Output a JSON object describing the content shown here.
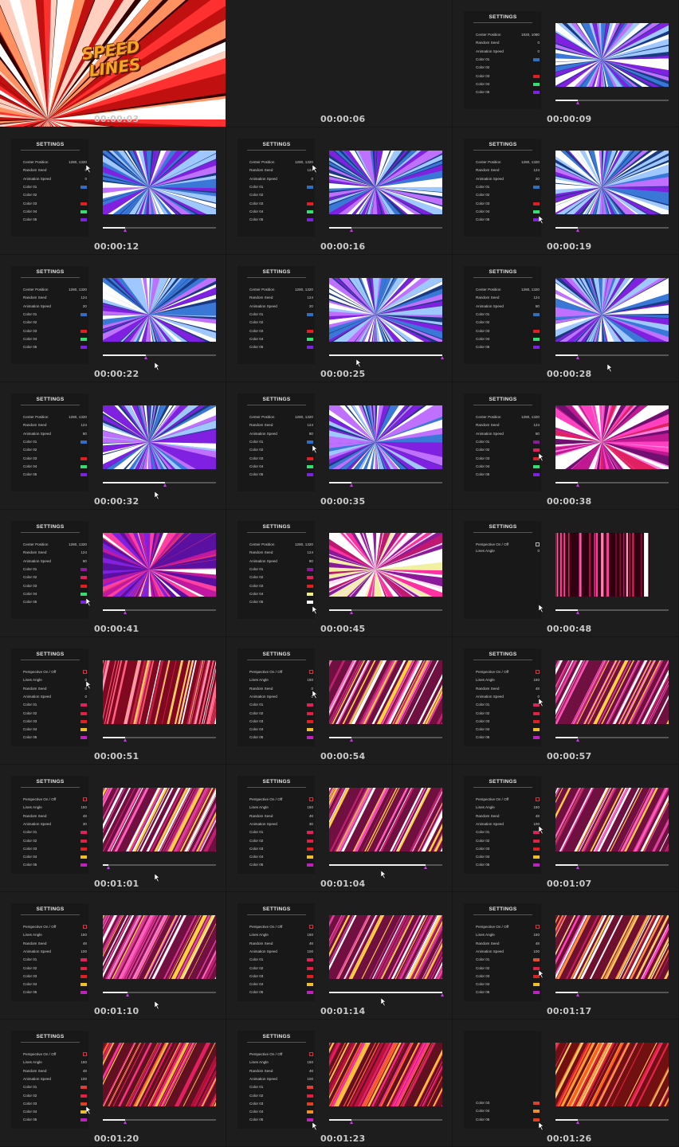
{
  "panel": {
    "title": "SETTINGS",
    "labels": {
      "center_position": "Center Position",
      "random_seed": "Random Seed",
      "animation_speed": "Animation Speed",
      "perspective": "Perspective On / Off",
      "lines_angle": "Lines Angle",
      "color_01": "Color 01",
      "color_02": "Color 02",
      "color_03": "Color 03",
      "color_04": "Color 04",
      "color_05": "Color 05"
    }
  },
  "title_art": {
    "line1": "SPEED",
    "line2": "LINES"
  },
  "colors": {
    "accent": "#c040e0",
    "background": "#1d1d1d"
  },
  "frames": [
    {
      "timestamp": "00:00:03",
      "kind": "intro"
    },
    {
      "timestamp": "00:00:06",
      "kind": "blank"
    },
    {
      "timestamp": "00:00:09",
      "kind": "radial",
      "center": "1920, 1080",
      "seed": "0",
      "speed": "0",
      "swatches": [
        "#2f6fbf",
        "",
        "#e02020",
        "#30e070",
        "#8020e0"
      ],
      "progress": 0.2,
      "preview": "blue-purple",
      "cursor": null
    },
    {
      "timestamp": "00:00:12",
      "kind": "radial",
      "center": "1280, 1320",
      "seed": "0",
      "speed": "0",
      "swatches": [
        "#2f6fbf",
        "",
        "#e02020",
        "#30e070",
        "#8020e0"
      ],
      "progress": 0.2,
      "preview": "blue-purple",
      "cursor": "seed"
    },
    {
      "timestamp": "00:00:16",
      "kind": "radial",
      "center": "1280, 1320",
      "seed": "124",
      "speed": "0",
      "swatches": [
        "#2f6fbf",
        "",
        "#e02020",
        "#30e070",
        "#8020e0"
      ],
      "progress": 0.2,
      "preview": "blue-purple",
      "cursor": "seed"
    },
    {
      "timestamp": "00:00:19",
      "kind": "radial",
      "center": "1280, 1320",
      "seed": "124",
      "speed": "20",
      "swatches": [
        "#2f6fbf",
        "",
        "#e02020",
        "#30e070",
        "#8020e0"
      ],
      "progress": 0.2,
      "preview": "blue-purple",
      "cursor": "color04"
    },
    {
      "timestamp": "00:00:22",
      "kind": "radial",
      "center": "1280, 1320",
      "seed": "124",
      "speed": "20",
      "swatches": [
        "#2f6fbf",
        "",
        "#e02020",
        "#30e070",
        "#8020e0"
      ],
      "progress": 0.38,
      "preview": "blue-purple",
      "cursor": "slider"
    },
    {
      "timestamp": "00:00:25",
      "kind": "radial",
      "center": "1280, 1320",
      "seed": "124",
      "speed": "20",
      "swatches": [
        "#2f6fbf",
        "",
        "#e02020",
        "#30e070",
        "#8020e0"
      ],
      "progress": 1.0,
      "preview": "blue-purple",
      "cursor": "slider"
    },
    {
      "timestamp": "00:00:28",
      "kind": "radial",
      "center": "1280, 1320",
      "seed": "124",
      "speed": "80",
      "swatches": [
        "#2f6fbf",
        "",
        "#e02020",
        "#30e070",
        "#8020e0"
      ],
      "progress": 0.2,
      "preview": "blue-purple",
      "cursor": "slider"
    },
    {
      "timestamp": "00:00:32",
      "kind": "radial",
      "center": "1280, 1320",
      "seed": "124",
      "speed": "80",
      "swatches": [
        "#2f6fbf",
        "",
        "#e02020",
        "#30e070",
        "#8020e0"
      ],
      "progress": 0.55,
      "preview": "blue-purple",
      "cursor": "slider"
    },
    {
      "timestamp": "00:00:35",
      "kind": "radial",
      "center": "1280, 1320",
      "seed": "124",
      "speed": "80",
      "swatches": [
        "#2f6fbf",
        "",
        "#e02020",
        "#30e070",
        "#8020e0"
      ],
      "progress": 0.2,
      "preview": "blue-purple",
      "cursor": "color01"
    },
    {
      "timestamp": "00:00:38",
      "kind": "radial",
      "center": "1280, 1320",
      "seed": "124",
      "speed": "80",
      "swatches": [
        "#8a1a9a",
        "#e0205a",
        "#e02020",
        "#30e070",
        "#8020e0"
      ],
      "progress": 0.2,
      "preview": "magenta",
      "cursor": "color02"
    },
    {
      "timestamp": "00:00:41",
      "kind": "radial",
      "center": "1280, 1320",
      "seed": "124",
      "speed": "80",
      "swatches": [
        "#8a1a9a",
        "#e0205a",
        "#e02020",
        "#30e070",
        "#8020e0"
      ],
      "progress": 0.2,
      "preview": "magenta-violet",
      "cursor": "color04"
    },
    {
      "timestamp": "00:00:45",
      "kind": "radial",
      "center": "1280, 1320",
      "seed": "124",
      "speed": "80",
      "swatches": [
        "#8a1a9a",
        "#e0205a",
        "#e02020",
        "#f0f080",
        "#ffffff"
      ],
      "progress": 0.2,
      "preview": "magenta-white",
      "cursor": "color05"
    },
    {
      "timestamp": "00:00:48",
      "kind": "vertical",
      "lines_angle": "0",
      "progress": 0.2,
      "cursor": "slider"
    },
    {
      "timestamp": "00:00:51",
      "kind": "parallel",
      "angle_val": "0",
      "seed": "0",
      "speed": "0",
      "swatches": [
        "#e0205a",
        "#e02040",
        "#e02020",
        "#f0c020",
        "#c020c0"
      ],
      "progress": 0.2,
      "preview": "fan-warm",
      "cursor": "perspective"
    },
    {
      "timestamp": "00:00:54",
      "kind": "parallel",
      "angle_val": "150",
      "seed": "0",
      "speed": "0",
      "swatches": [
        "#e0205a",
        "#e02040",
        "#e02020",
        "#f0c020",
        "#c020c0"
      ],
      "progress": 0.2,
      "preview": "diag-pink",
      "cursor": "seed"
    },
    {
      "timestamp": "00:00:57",
      "kind": "parallel",
      "angle_val": "150",
      "seed": "48",
      "speed": "0",
      "swatches": [
        "#e0205a",
        "#e02040",
        "#e02020",
        "#f0c020",
        "#c020c0"
      ],
      "progress": 0.2,
      "preview": "diag-pink",
      "cursor": "speed"
    },
    {
      "timestamp": "00:01:01",
      "kind": "parallel",
      "angle_val": "150",
      "seed": "48",
      "speed": "30",
      "swatches": [
        "#e0205a",
        "#e02040",
        "#e02020",
        "#f0c020",
        "#c020c0"
      ],
      "progress": 0.05,
      "preview": "diag-pink",
      "cursor": "slider"
    },
    {
      "timestamp": "00:01:04",
      "kind": "parallel",
      "angle_val": "150",
      "seed": "48",
      "speed": "30",
      "swatches": [
        "#e0205a",
        "#e02040",
        "#e02020",
        "#f0c020",
        "#c020c0"
      ],
      "progress": 0.85,
      "preview": "diag-pink",
      "cursor": "slider"
    },
    {
      "timestamp": "00:01:07",
      "kind": "parallel",
      "angle_val": "150",
      "seed": "48",
      "speed": "100",
      "swatches": [
        "#e0205a",
        "#e02040",
        "#e02020",
        "#f0c020",
        "#c020c0"
      ],
      "progress": 0.2,
      "preview": "diag-pink",
      "cursor": "speed"
    },
    {
      "timestamp": "00:01:10",
      "kind": "parallel",
      "angle_val": "150",
      "seed": "48",
      "speed": "100",
      "swatches": [
        "#e0205a",
        "#e02040",
        "#e02020",
        "#f0c020",
        "#c020c0"
      ],
      "progress": 0.22,
      "preview": "diag-pink",
      "cursor": "slider"
    },
    {
      "timestamp": "00:01:14",
      "kind": "parallel",
      "angle_val": "150",
      "seed": "48",
      "speed": "100",
      "swatches": [
        "#e0205a",
        "#e02040",
        "#e02020",
        "#f0c020",
        "#c020c0"
      ],
      "progress": 1.0,
      "preview": "diag-pink",
      "cursor": "slider"
    },
    {
      "timestamp": "00:01:17",
      "kind": "parallel",
      "angle_val": "150",
      "seed": "48",
      "speed": "100",
      "swatches": [
        "#e05020",
        "#e02040",
        "#e02020",
        "#f0c020",
        "#c020c0"
      ],
      "progress": 0.2,
      "preview": "diag-orange-pink",
      "cursor": "color02"
    },
    {
      "timestamp": "00:01:20",
      "kind": "parallel",
      "angle_val": "150",
      "seed": "48",
      "speed": "100",
      "swatches": [
        "#e04030",
        "#e02040",
        "#e04020",
        "#f0c020",
        "#c020c0"
      ],
      "progress": 0.2,
      "preview": "diag-red",
      "cursor": "color03"
    },
    {
      "timestamp": "00:01:23",
      "kind": "parallel",
      "angle_val": "150",
      "seed": "48",
      "speed": "100",
      "swatches": [
        "#e04030",
        "#e02040",
        "#e04020",
        "#f09020",
        "#c020c0"
      ],
      "progress": 0.2,
      "preview": "diag-red",
      "cursor": "color05"
    },
    {
      "timestamp": "00:01:26",
      "kind": "partial",
      "swatches": [
        "#e04030",
        "#f09020",
        "#e04020"
      ],
      "progress": 0.2,
      "preview": "diag-orange",
      "cursor": "color05"
    }
  ]
}
